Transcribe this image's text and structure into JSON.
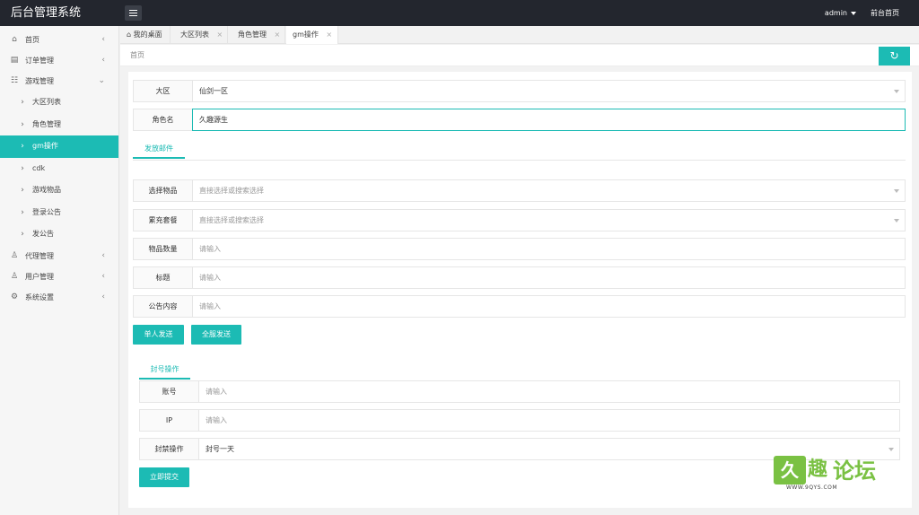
{
  "app": {
    "title": "后台管理系统"
  },
  "top": {
    "user": "admin",
    "home_link": "前台首页"
  },
  "sidebar": {
    "items": [
      {
        "label": "首页",
        "icon": "home-icon",
        "glyph": "⌂",
        "arrow": "‹"
      },
      {
        "label": "订单管理",
        "icon": "order-icon",
        "glyph": "▤",
        "arrow": "‹"
      },
      {
        "label": "游戏管理",
        "icon": "sitemap-icon",
        "glyph": "☷",
        "arrow": "⌄"
      },
      {
        "label": "大区列表",
        "icon": "chevron-right-icon",
        "glyph": "›"
      },
      {
        "label": "角色管理",
        "icon": "chevron-right-icon",
        "glyph": "›"
      },
      {
        "label": "gm操作",
        "icon": "chevron-right-icon",
        "glyph": "›"
      },
      {
        "label": "cdk",
        "icon": "chevron-right-icon",
        "glyph": "›"
      },
      {
        "label": "游戏物品",
        "icon": "chevron-right-icon",
        "glyph": "›"
      },
      {
        "label": "登录公告",
        "icon": "chevron-right-icon",
        "glyph": "›"
      },
      {
        "label": "发公告",
        "icon": "chevron-right-icon",
        "glyph": "›"
      },
      {
        "label": "代理管理",
        "icon": "user-icon",
        "glyph": "♙",
        "arrow": "‹"
      },
      {
        "label": "用户管理",
        "icon": "user-icon",
        "glyph": "♙",
        "arrow": "‹"
      },
      {
        "label": "系统设置",
        "icon": "gear-icon",
        "glyph": "⚙",
        "arrow": "‹"
      }
    ]
  },
  "tabs": [
    {
      "label": "我的桌面",
      "icon": "home-icon",
      "glyph": "⌂"
    },
    {
      "label": "大区列表",
      "close": "×"
    },
    {
      "label": "角色管理",
      "close": "×"
    },
    {
      "label": "gm操作",
      "close": "×"
    }
  ],
  "breadcrumb": {
    "text": "首页"
  },
  "refresh_glyph": "↻",
  "form_top": {
    "region": {
      "label": "大区",
      "value": "仙剑一区"
    },
    "role": {
      "label": "角色名",
      "value": "久趣源生"
    }
  },
  "mail": {
    "tab_label": "发放邮件",
    "item": {
      "label": "选择物品",
      "placeholder": "直接选择或搜索选择"
    },
    "recharge": {
      "label": "累充套餐",
      "placeholder": "直接选择或搜索选择"
    },
    "quantity": {
      "label": "物品数量",
      "placeholder": "请输入"
    },
    "subject": {
      "label": "标题",
      "placeholder": "请输入"
    },
    "content": {
      "label": "公告内容",
      "placeholder": "请输入"
    },
    "send_single": "单人发送",
    "send_all": "全服发送"
  },
  "ban": {
    "tab_label": "封号操作",
    "account": {
      "label": "账号",
      "placeholder": "请输入"
    },
    "ip": {
      "label": "IP",
      "placeholder": "请输入"
    },
    "action": {
      "label": "封禁操作",
      "value": "封号一天"
    },
    "submit": "立即提交"
  },
  "watermark": {
    "mark1": "久",
    "mark2": "趣",
    "text": "论坛",
    "url": "WWW.9QYS.COM"
  },
  "colors": {
    "accent": "#1cbbb4",
    "topbar": "#23262e",
    "watermark": "#7ac143"
  }
}
